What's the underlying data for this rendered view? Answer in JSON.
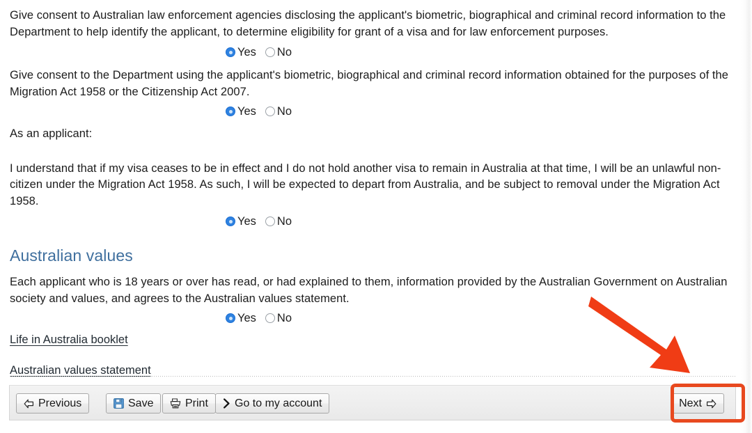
{
  "form": {
    "consent_items": [
      {
        "text": "Give consent to Australian law enforcement agencies disclosing the applicant's biometric, biographical and criminal record information to the Department to help identify the applicant, to determine eligibility for grant of a visa and for law enforcement purposes.",
        "yes_label": "Yes",
        "no_label": "No",
        "selected": "Yes"
      },
      {
        "text": "Give consent to the Department using the applicant's biometric, biographical and criminal record information obtained for the purposes of the Migration Act 1958 or the Citizenship Act 2007.",
        "yes_label": "Yes",
        "no_label": "No",
        "selected": "Yes"
      }
    ],
    "applicant_heading": "As an applicant:",
    "declaration": {
      "text": "I understand that if my visa ceases to be in effect and I do not hold another visa to remain in Australia at that time, I will be an unlawful non-citizen under the Migration Act 1958. As such, I will be expected to depart from Australia, and be subject to removal under the Migration Act 1958.",
      "yes_label": "Yes",
      "no_label": "No",
      "selected": "Yes"
    },
    "australian_values": {
      "section_title": "Australian values",
      "text": "Each applicant who is 18 years or over has read, or had explained to them, information provided by the Australian Government on Australian society and values, and agrees to the Australian values statement.",
      "yes_label": "Yes",
      "no_label": "No",
      "selected": "Yes",
      "links": [
        {
          "label": "Life in Australia booklet"
        },
        {
          "label": "Australian values statement"
        }
      ]
    }
  },
  "toolbar": {
    "previous_label": "Previous",
    "save_label": "Save",
    "print_label": "Print",
    "account_label": "Go to my account",
    "next_label": "Next",
    "icons": {
      "previous": "arrow-left-outline-icon",
      "save": "floppy-disk-icon",
      "print": "printer-icon",
      "account": "chevron-right-icon",
      "next": "arrow-right-outline-icon"
    }
  },
  "annotations": {
    "arrow": {
      "name": "red-pointer-arrow",
      "color": "#f03c15",
      "points_to": "Next"
    },
    "highlight": {
      "name": "next-button-highlight-box",
      "color": "#e8491f"
    }
  }
}
